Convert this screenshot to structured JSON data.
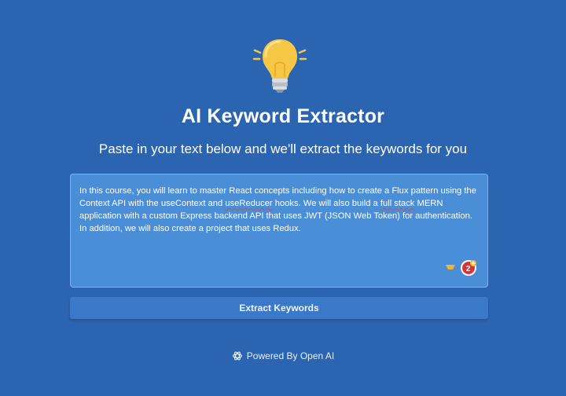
{
  "header": {
    "title": "AI Keyword Extractor",
    "subtitle": "Paste in your text below and we'll extract the keywords for you",
    "icon": "lightbulb-icon"
  },
  "input": {
    "text_parts": [
      "In this course, you will learn to master React concepts including how to create a Flux pattern using the Context API with the useContext and ",
      "useReducer",
      " hooks. We will also build a ",
      "full stack",
      " MERN application with a custom Express backend API that uses JWT (JSON Web Token) for authentication. In addition, we will also create a project that uses Redux."
    ],
    "grammar_badge_count": "2"
  },
  "actions": {
    "extract_label": "Extract Keywords"
  },
  "footer": {
    "powered_by": "Powered By Open AI",
    "icon": "openai-logo-icon"
  },
  "colors": {
    "background": "#2b64b0",
    "textarea": "#4a8ed8",
    "button": "#3a78c8",
    "bulb": "#f6c745",
    "spellcheck": "#e0464d"
  }
}
